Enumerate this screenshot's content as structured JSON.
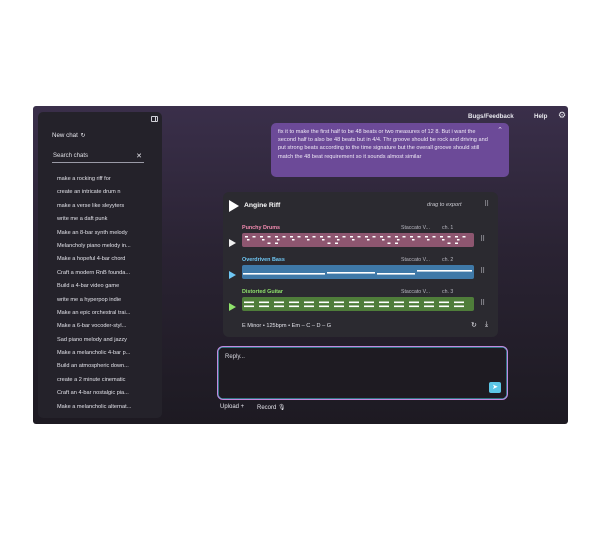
{
  "sidebar": {
    "new_chat": "New chat",
    "new_chat_icon": "↻",
    "search_placeholder": "Search chats",
    "clear_icon": "✕",
    "chats": [
      "make a rocking riff for",
      "create an intricate drum n",
      "make a verse like sleyyters",
      "write me a daft punk",
      "Make an 8-bar synth melody",
      "Melancholy piano melody in...",
      "Make a hopeful 4-bar chord",
      "Craft a modern RnB founda...",
      "Build a 4-bar video game",
      "write me a hyperpop indie",
      "Make an epic orchestral trai...",
      "Make a 6-bar vocoder-styl...",
      "Sad piano melody and jazzy",
      "Make a melancholic 4-bar p...",
      "Build an atmospheric down...",
      "create a 2 minute cinematic",
      "Craft an 4-bar nostalgic pia...",
      "Make a melancholic alternat..."
    ]
  },
  "header": {
    "bugs": "Bugs/Feedback",
    "help": "Help"
  },
  "message": {
    "text": "fix it to make the first half to be 48 beats or two measures of 12 8. But i want the second half to also be 48 beats but in 4/4. Thr groove should be rock and driving and put strong beats according to the time signature but the overall groove should still match the 48 beat requirement so it sounds almost similar"
  },
  "player": {
    "title": "Angine Riff",
    "drag_label": "drag to export",
    "tracks": [
      {
        "name": "Punchy Drums",
        "style": "Staccato V...",
        "channel": "ch. 1",
        "name_color": "#f28bb0",
        "lane_color": "#8e5670",
        "note_color": "#ffffff"
      },
      {
        "name": "Overdriven Bass",
        "style": "Staccato V...",
        "channel": "ch. 2",
        "name_color": "#6fc8f5",
        "lane_color": "#3f79a8",
        "note_color": "#ffffff"
      },
      {
        "name": "Distorted Guitar",
        "style": "Staccato V...",
        "channel": "ch. 3",
        "name_color": "#8fe36c",
        "lane_color": "#4f7d3a",
        "note_color": "#ffffff"
      }
    ],
    "footer": "E Minor • 125bpm • Em – C – D – G"
  },
  "reply": {
    "placeholder": "Reply...",
    "upload": "Upload +",
    "record": "Record 🎙"
  },
  "icons": {
    "settings": "gear-icon",
    "send": "paper-plane-icon",
    "refresh": "refresh-icon",
    "download": "download-icon"
  }
}
